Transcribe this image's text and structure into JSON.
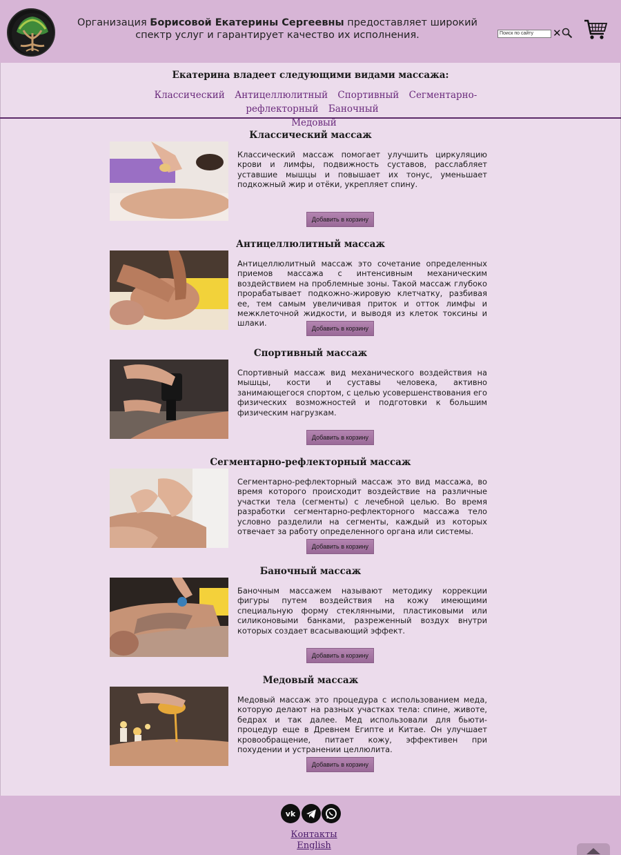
{
  "header": {
    "text_prefix": "Организация ",
    "text_name": "Борисовой Екатерины Сергеевны",
    "text_suffix": " предоставляет широкий спектр услуг и гарантирует качество их исполнения.",
    "search_placeholder": "Поиск по сайту",
    "search_clear": "✕"
  },
  "intro": {
    "title": "Екатерина владеет следующими видами массажа:",
    "nav": [
      "Классический",
      "Антицеллюлитный",
      "Спортивный",
      "Сегментарно-рефлекторный",
      "Баночный",
      "Медовый"
    ]
  },
  "sections": [
    {
      "title": "Классический массаж",
      "text": "Классический массаж помогает улучшить циркуляцию крови и лимфы, подвижность суставов, расслабляет уставшие мышцы и повышает их тонус, уменьшает подкожный жир и отёки, укрепляет спину.",
      "button": "Добавить в корзину"
    },
    {
      "title": "Антицеллюлитный массаж",
      "text": "Антицеллюлитный массаж это сочетание определенных приемов массажа с интенсивным механическим воздействием на проблемные зоны. Такой массаж глубоко прорабатывает подкожно-жировую клетчатку, разбивая ее, тем самым увеличивая приток и отток лимфы и межклеточной жидкости, и выводя из клеток токсины и шлаки.",
      "button": "Добавить в корзину"
    },
    {
      "title": "Спортивный массаж",
      "text": "Спортивный массаж вид механического воздействия на мышцы, кости и суставы человека, активно занимающегося спортом, с целью усовершенствования его физических возможностей и подготовки к большим физическим нагрузкам.",
      "button": "Добавить в корзину"
    },
    {
      "title": "Сегментарно-рефлекторный массаж",
      "text": "Сегментарно-рефлекторный массаж это вид массажа, во время которого происходит воздействие на различные участки тела (сегменты) с лечебной целью. Во время разработки сегментарно-рефлекторного массажа тело условно разделили на сегменты, каждый из которых отвечает за работу определенного органа или системы.",
      "button": "Добавить в корзину"
    },
    {
      "title": "Баночный массаж",
      "text": "Баночным массажем называют методику коррекции фигуры путем воздействия на кожу имеющими специальную форму стеклянными, пластиковыми или силиконовыми банками, разреженный воздух внутри которых создает всасывающий эффект.",
      "button": "Добавить в корзину"
    },
    {
      "title": "Медовый массаж",
      "text": "Медовый массаж это процедура с использованием меда, которую делают на разных участках тела: спине, животе, бедрах и так далее. Мед использовали для бьюти-процедур еще в Древнем Египте и Китае. Он улучшает кровообращение, питает кожу, эффективен при похудении и устранении целлюлита.",
      "button": "Добавить в корзину"
    }
  ],
  "footer": {
    "social": [
      "vk-icon",
      "telegram-icon",
      "whatsapp-icon"
    ],
    "contacts": "Контакты",
    "english": "English"
  }
}
